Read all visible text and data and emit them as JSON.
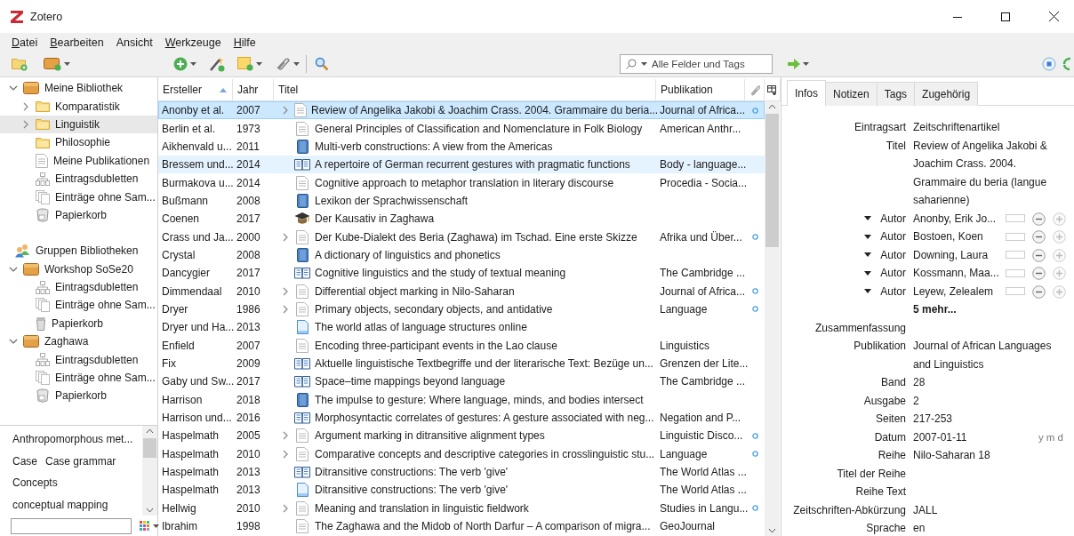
{
  "window": {
    "title": "Zotero"
  },
  "menu": [
    {
      "label": "Datei",
      "underlined": true
    },
    {
      "label": "Bearbeiten",
      "underlined": true
    },
    {
      "label": "Ansicht",
      "underlined": false
    },
    {
      "label": "Werkzeuge",
      "underlined": true
    },
    {
      "label": "Hilfe",
      "underlined": true
    }
  ],
  "search": {
    "placeholder": "Alle Felder und Tags"
  },
  "tree": [
    {
      "label": "Meine Bibliothek",
      "kind": "library",
      "expandable": true,
      "expanded": true,
      "selected": false,
      "children": [
        {
          "label": "Komparatistik",
          "kind": "folder",
          "expandable": true,
          "expanded": false,
          "selected": false
        },
        {
          "label": "Linguistik",
          "kind": "folder",
          "expandable": true,
          "expanded": false,
          "selected": true
        },
        {
          "label": "Philosophie",
          "kind": "folder",
          "expandable": false,
          "expanded": false,
          "selected": false
        },
        {
          "label": "Meine Publikationen",
          "kind": "page",
          "expandable": false,
          "expanded": false,
          "selected": false
        },
        {
          "label": "Eintragsdubletten",
          "kind": "duplicates",
          "expandable": false,
          "expanded": false,
          "selected": false
        },
        {
          "label": "Einträge ohne Sam...",
          "kind": "unfiled",
          "expandable": false,
          "expanded": false,
          "selected": false
        },
        {
          "label": "Papierkorb",
          "kind": "trash",
          "expandable": false,
          "expanded": false,
          "selected": false
        }
      ]
    },
    {
      "label": "Gruppen Bibliotheken",
      "kind": "groups",
      "expandable": false,
      "expanded": false,
      "selected": false
    },
    {
      "label": "Workshop SoSe20",
      "kind": "library",
      "expandable": true,
      "expanded": true,
      "selected": false,
      "children": [
        {
          "label": "Eintragsdubletten",
          "kind": "duplicates",
          "expandable": false,
          "expanded": false,
          "selected": false
        },
        {
          "label": "Einträge ohne Sam...",
          "kind": "unfiled",
          "expandable": false,
          "expanded": false,
          "selected": false
        },
        {
          "label": "Papierkorb",
          "kind": "bin",
          "expandable": false,
          "expanded": false,
          "selected": false
        }
      ]
    },
    {
      "label": "Zaghawa",
      "kind": "library",
      "expandable": true,
      "expanded": true,
      "selected": false,
      "children": [
        {
          "label": "Eintragsdubletten",
          "kind": "duplicates",
          "expandable": false,
          "expanded": false,
          "selected": false
        },
        {
          "label": "Einträge ohne Sam...",
          "kind": "unfiled",
          "expandable": false,
          "expanded": false,
          "selected": false
        },
        {
          "label": "Papierkorb",
          "kind": "trash",
          "expandable": false,
          "expanded": false,
          "selected": false
        }
      ]
    }
  ],
  "tags": [
    {
      "label": "Anthropomorphous met..."
    },
    {
      "label": "Case"
    },
    {
      "label": "Case grammar"
    },
    {
      "label": "Concepts"
    },
    {
      "label": "conceptual mapping"
    }
  ],
  "table": {
    "columns": [
      {
        "label": "Ersteller",
        "sorted": true
      },
      {
        "label": "Jahr",
        "sorted": false
      },
      {
        "label": "Titel",
        "sorted": false
      },
      {
        "label": "Publikation",
        "sorted": false
      }
    ],
    "rows": [
      {
        "creator": "Anonby et al.",
        "year": "2007",
        "title": "Review of Angelika Jakobi & Joachim Crass. 2004. Grammaire du beria...",
        "publication": "Journal of Africa...",
        "kind": "article",
        "expandable": true,
        "attachment": true,
        "selected": true,
        "highlighted": false
      },
      {
        "creator": "Berlin et al.",
        "year": "1973",
        "title": "General Principles of Classification and Nomenclature in Folk Biology",
        "publication": "American Anthr...",
        "kind": "article",
        "expandable": false,
        "attachment": false,
        "selected": false,
        "highlighted": false
      },
      {
        "creator": "Aikhenvald u...",
        "year": "2011",
        "title": "Multi-verb constructions: A view from the Americas",
        "kind": "book",
        "expandable": false,
        "attachment": false,
        "selected": false,
        "highlighted": false
      },
      {
        "creator": "Bressem und...",
        "year": "2014",
        "title": "A repertoire of German recurrent gestures with pragmatic functions",
        "publication": "Body - language...",
        "kind": "section",
        "expandable": false,
        "attachment": false,
        "selected": false,
        "highlighted": true
      },
      {
        "creator": "Burmakova u...",
        "year": "2014",
        "title": "Cognitive approach to metaphor translation in literary discourse",
        "publication": "Procedia - Socia...",
        "kind": "article",
        "expandable": false,
        "attachment": false,
        "selected": false,
        "highlighted": false
      },
      {
        "creator": "Bußmann",
        "year": "2008",
        "title": "Lexikon der Sprachwissenschaft",
        "kind": "book",
        "expandable": false,
        "attachment": false,
        "selected": false,
        "highlighted": false
      },
      {
        "creator": "Coenen",
        "year": "2017",
        "title": "Der Kausativ in Zaghawa",
        "kind": "thesis",
        "expandable": false,
        "attachment": false,
        "selected": false,
        "highlighted": false
      },
      {
        "creator": "Crass und Ja...",
        "year": "2000",
        "title": "Der Kube-Dialekt des Beria (Zaghawa) im Tschad. Eine erste Skizze",
        "publication": "Afrika und Über...",
        "kind": "article",
        "expandable": true,
        "attachment": true,
        "selected": false,
        "highlighted": false
      },
      {
        "creator": "Crystal",
        "year": "2008",
        "title": "A dictionary of linguistics and phonetics",
        "kind": "book",
        "expandable": false,
        "attachment": false,
        "selected": false,
        "highlighted": false
      },
      {
        "creator": "Dancygier",
        "year": "2017",
        "title": "Cognitive linguistics and the study of textual meaning",
        "publication": "The Cambridge ...",
        "kind": "section",
        "expandable": false,
        "attachment": false,
        "selected": false,
        "highlighted": false
      },
      {
        "creator": "Dimmendaal",
        "year": "2010",
        "title": "Differential object marking in Nilo-Saharan",
        "publication": "Journal of Africa...",
        "kind": "article",
        "expandable": true,
        "attachment": true,
        "selected": false,
        "highlighted": false
      },
      {
        "creator": "Dryer",
        "year": "1986",
        "title": "Primary objects, secondary objects, and antidative",
        "publication": "Language",
        "kind": "article",
        "expandable": true,
        "attachment": true,
        "selected": false,
        "highlighted": false
      },
      {
        "creator": "Dryer und Ha...",
        "year": "2013",
        "title": "The world atlas of language structures online",
        "kind": "web",
        "expandable": false,
        "attachment": false,
        "selected": false,
        "highlighted": false
      },
      {
        "creator": "Enfield",
        "year": "2007",
        "title": "Encoding three-participant events in the Lao clause",
        "publication": "Linguistics",
        "kind": "article",
        "expandable": false,
        "attachment": false,
        "selected": false,
        "highlighted": false
      },
      {
        "creator": "Fix",
        "year": "2009",
        "title": "Aktuelle linguistische Textbegriffe und der literarische Text: Bezüge un...",
        "publication": "Grenzen der Lite...",
        "kind": "section",
        "expandable": false,
        "attachment": false,
        "selected": false,
        "highlighted": false
      },
      {
        "creator": "Gaby und Sw...",
        "year": "2017",
        "title": "Space–time mappings beyond language",
        "publication": "The Cambridge ...",
        "kind": "section",
        "expandable": false,
        "attachment": false,
        "selected": false,
        "highlighted": false
      },
      {
        "creator": "Harrison",
        "year": "2018",
        "title": "The impulse to gesture: Where language, minds, and bodies intersect",
        "kind": "book",
        "expandable": false,
        "attachment": false,
        "selected": false,
        "highlighted": false
      },
      {
        "creator": "Harrison und...",
        "year": "2016",
        "title": "Morphosyntactic correlates of gestures: A gesture associated with neg...",
        "publication": "Negation and P...",
        "kind": "section",
        "expandable": false,
        "attachment": false,
        "selected": false,
        "highlighted": false
      },
      {
        "creator": "Haspelmath",
        "year": "2005",
        "title": "Argument marking in ditransitive alignment types",
        "publication": "Linguistic Disco...",
        "kind": "article",
        "expandable": true,
        "attachment": true,
        "selected": false,
        "highlighted": false
      },
      {
        "creator": "Haspelmath",
        "year": "2010",
        "title": "Comparative concepts and descriptive categories in crosslinguistic stu...",
        "publication": "Language",
        "kind": "article",
        "expandable": true,
        "attachment": true,
        "selected": false,
        "highlighted": false
      },
      {
        "creator": "Haspelmath",
        "year": "2013",
        "title": "Ditransitive constructions: The verb 'give'",
        "publication": "The World Atlas ...",
        "kind": "section",
        "expandable": false,
        "attachment": false,
        "selected": false,
        "highlighted": false
      },
      {
        "creator": "Haspelmath",
        "year": "2013",
        "title": "Ditransitive constructions: The verb 'give'",
        "publication": "The World Atlas ...",
        "kind": "web",
        "expandable": false,
        "attachment": false,
        "selected": false,
        "highlighted": false
      },
      {
        "creator": "Hellwig",
        "year": "2010",
        "title": "Meaning and translation in linguistic fieldwork",
        "publication": "Studies in Langu...",
        "kind": "article",
        "expandable": true,
        "attachment": true,
        "selected": false,
        "highlighted": false
      },
      {
        "creator": "Ibrahim",
        "year": "1998",
        "title": "The Zaghawa and the Midob of North Darfur – A comparison of migra...",
        "publication": "GeoJournal",
        "kind": "article",
        "expandable": false,
        "attachment": false,
        "selected": false,
        "highlighted": false
      }
    ]
  },
  "pane_tabs": [
    {
      "label": "Infos",
      "selected": true
    },
    {
      "label": "Notizen",
      "selected": false
    },
    {
      "label": "Tags",
      "selected": false
    },
    {
      "label": "Zugehörig",
      "selected": false
    }
  ],
  "info": [
    {
      "kind": "field",
      "label": "Eintragsart",
      "value": "Zeitschriftenartikel"
    },
    {
      "kind": "field",
      "label": "Titel",
      "value": "Review of Angelika Jakobi & Joachim Crass. 2004. Grammaire du beria (langue saharienne)"
    },
    {
      "kind": "creator",
      "label": "Autor",
      "value": "Anonby, Erik Jo..."
    },
    {
      "kind": "creator",
      "label": "Autor",
      "value": "Bostoen, Koen"
    },
    {
      "kind": "creator",
      "label": "Autor",
      "value": "Downing, Laura"
    },
    {
      "kind": "creator",
      "label": "Autor",
      "value": "Kossmann, Maa..."
    },
    {
      "kind": "creator",
      "label": "Autor",
      "value": "Leyew, Zelealem"
    },
    {
      "kind": "more",
      "value": "5 mehr..."
    },
    {
      "kind": "field",
      "label": "Zusammenfassung"
    },
    {
      "kind": "field",
      "label": "Publikation",
      "value": "Journal of African Languages and Linguistics"
    },
    {
      "kind": "field",
      "label": "Band",
      "value": "28"
    },
    {
      "kind": "field",
      "label": "Ausgabe",
      "value": "2"
    },
    {
      "kind": "field",
      "label": "Seiten",
      "value": "217-253"
    },
    {
      "kind": "date",
      "label": "Datum",
      "value": "2007-01-11",
      "hint": "y m d"
    },
    {
      "kind": "field",
      "label": "Reihe",
      "value": "Nilo-Saharan 18"
    },
    {
      "kind": "field",
      "label": "Titel der Reihe"
    },
    {
      "kind": "field",
      "label": "Reihe Text"
    },
    {
      "kind": "field",
      "label": "Zeitschriften-Abkürzung",
      "value": "JALL"
    },
    {
      "kind": "field",
      "label": "Sprache",
      "value": "en"
    }
  ]
}
